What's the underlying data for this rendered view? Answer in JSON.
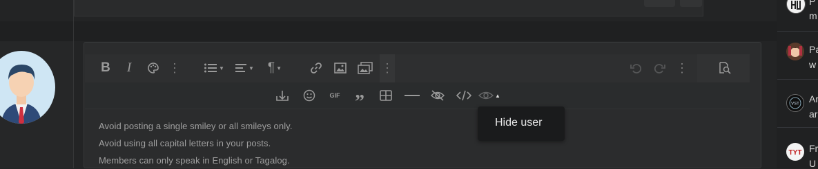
{
  "toolbar": {
    "row1": [
      {
        "name": "bold-icon",
        "glyph": "B"
      },
      {
        "name": "italic-icon",
        "glyph": "I"
      },
      {
        "name": "palette-icon"
      },
      {
        "name": "more-options-icon"
      },
      {
        "name": "list-icon"
      },
      {
        "name": "align-icon"
      },
      {
        "name": "paragraph-icon",
        "glyph": "¶"
      },
      {
        "name": "link-icon"
      },
      {
        "name": "image-icon"
      },
      {
        "name": "media-gallery-icon"
      },
      {
        "name": "more-insert-icon"
      },
      {
        "name": "undo-icon"
      },
      {
        "name": "redo-icon"
      },
      {
        "name": "more-history-icon"
      },
      {
        "name": "preview-icon"
      }
    ],
    "row2": [
      {
        "name": "insert-attachment-icon"
      },
      {
        "name": "smiley-icon"
      },
      {
        "name": "gif-icon",
        "glyph": "GIF"
      },
      {
        "name": "quote-icon"
      },
      {
        "name": "table-icon"
      },
      {
        "name": "horizontal-line-icon"
      },
      {
        "name": "spoiler-icon"
      },
      {
        "name": "code-icon",
        "glyph": "</>"
      },
      {
        "name": "hide-content-icon"
      }
    ]
  },
  "tooltip": {
    "label": "Hide user"
  },
  "content": {
    "lines": [
      "Avoid posting a single smiley or all smileys only.",
      "Avoid using all capital letters in your posts.",
      "Members can only speak in English or Tagalog."
    ]
  },
  "sidebar": {
    "items": [
      {
        "line1": "P",
        "line2": "m"
      },
      {
        "line1": "Pa",
        "line2": "w"
      },
      {
        "line1": "Ar",
        "line2": "ar"
      },
      {
        "line1": "Fr",
        "line2": "U"
      }
    ]
  },
  "colors": {
    "background": "#232425",
    "editor": "#2b2c2d",
    "toolbar": "#2e2f30",
    "tooltip": "#1a1b1c",
    "icon": "#9a9a9a"
  }
}
